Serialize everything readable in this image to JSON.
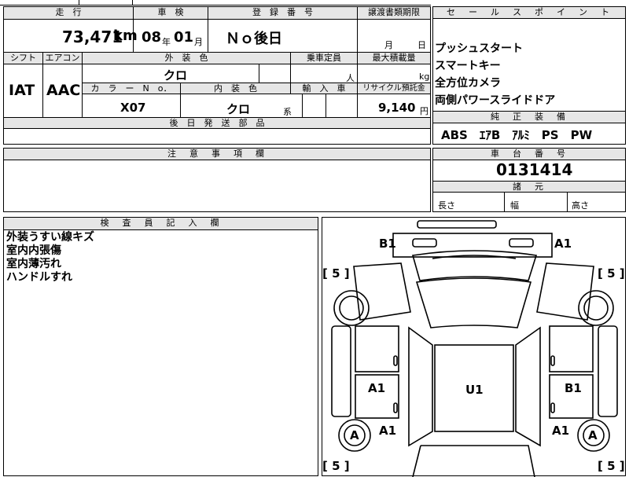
{
  "top_fragment": {
    "text1": "",
    "text2": ""
  },
  "headers": {
    "mileage": "走　行",
    "inspection": "車　検",
    "registration": "登　録　番　号",
    "transfer_deadline": "譲渡書類期限",
    "shift": "シフト",
    "aircon": "エアコン",
    "exterior_color": "外　装　色",
    "capacity": "乗車定員",
    "max_load": "最大積載量",
    "color_no": "カ　ラ　ー　N　o．",
    "interior_color": "内　装　色",
    "import": "輸　入　車",
    "recycle": "リサイクル預託金",
    "later_parts": "後　日　発　送　部　品",
    "notes": "注　意　事　項　欄",
    "inspector": "検　査　員　記　入　欄",
    "sales_points": "セ　ー　ル　ス　ポ　イ　ン　ト",
    "equipment": "純　正　装　備",
    "chassis_no": "車　台　番　号",
    "dimensions": "諸　元"
  },
  "values": {
    "mileage": "73,471",
    "mileage_unit": "km",
    "inspection_year": "08",
    "year_unit": "年",
    "inspection_month": "01",
    "month_unit": "月",
    "registration": "Ｎｏ後日",
    "transfer_month_unit": "月",
    "transfer_day_unit": "日",
    "shift": "IAT",
    "aircon": "AAC",
    "exterior_color": "クロ",
    "capacity_unit": "人",
    "load_unit": "kg",
    "color_no": "X07",
    "interior_color": "クロ",
    "interior_suffix": "系",
    "recycle_fee": "9,140",
    "yen_unit": "円",
    "chassis_no": "0131414",
    "length_label": "長さ",
    "width_label": "幅",
    "height_label": "高さ"
  },
  "sales_points": [
    "プッシュスタート",
    "スマートキー",
    "全方位カメラ",
    "両側パワースライドドア"
  ],
  "equipment": "ABS　ｴｱB　ｱﾙﾐ　PS　PW",
  "inspector_notes": [
    "外装うすい線キズ",
    "室内内張傷",
    "室内薄汚れ",
    "ハンドルすれ"
  ],
  "diagram_marks": {
    "front_left": "B1",
    "front_right": "A1",
    "left_front_tire": "[ 5 ]",
    "right_front_tire": "[ 5 ]",
    "left_rear_door": "A1",
    "right_rear_door": "B1",
    "roof": "U1",
    "left_rear_quarter": "A1",
    "right_rear_quarter": "A1",
    "left_rear_wheel": "A",
    "right_rear_wheel": "A",
    "left_rear_tire": "[ 5 ]",
    "right_rear_tire": "[ 5 ]"
  }
}
